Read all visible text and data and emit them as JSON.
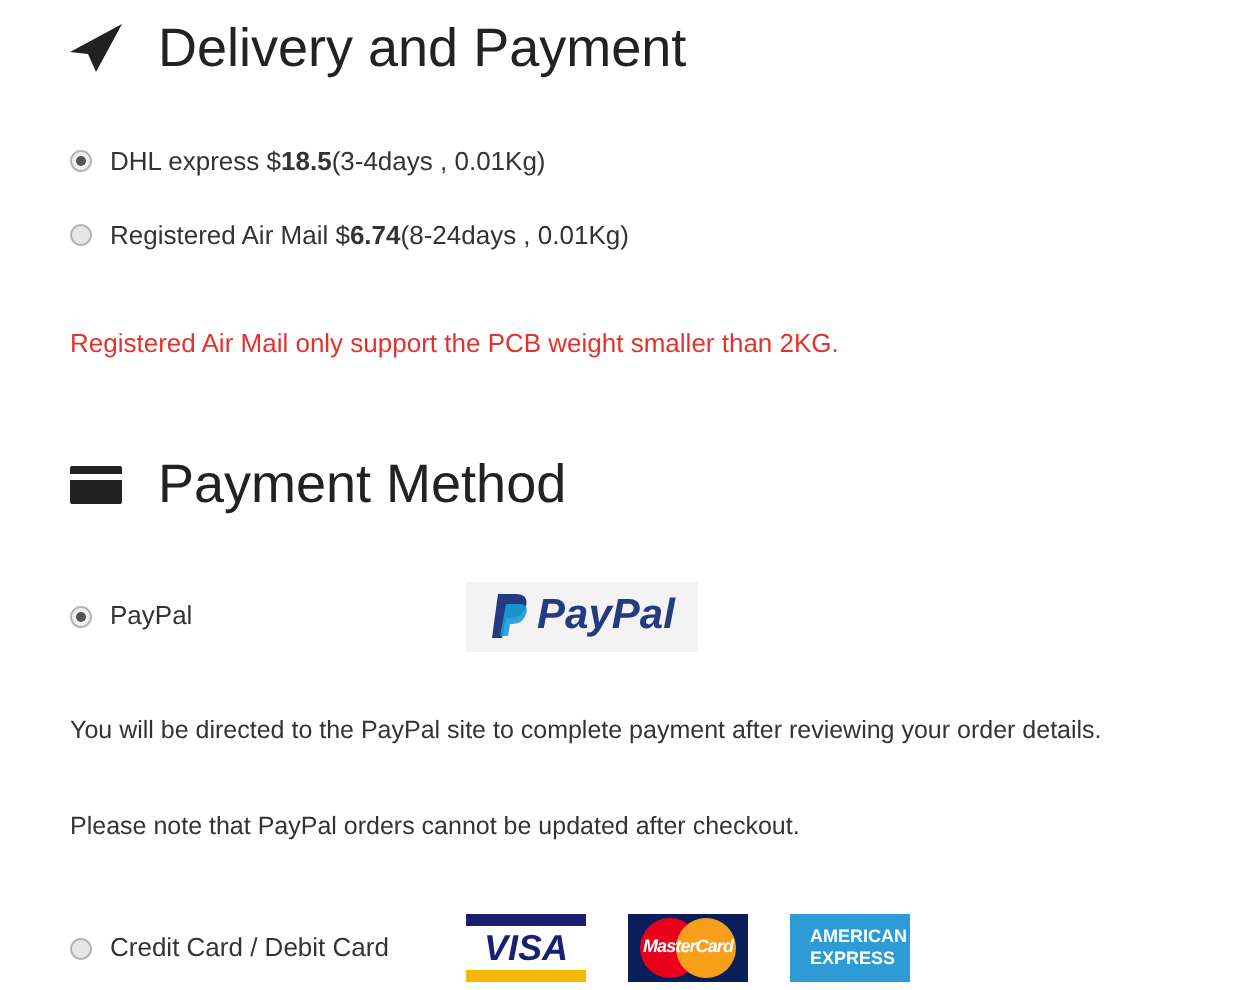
{
  "delivery": {
    "title": "Delivery and Payment",
    "options": [
      {
        "label": "DHL express $**18.5**(3-4days , 0.01Kg)",
        "selected": true
      },
      {
        "label": "Registered Air Mail $**6.74**(8-24days , 0.01Kg)",
        "selected": false
      }
    ],
    "warning": "Registered Air Mail only support the PCB weight smaller than 2KG."
  },
  "payment": {
    "title": "Payment Method",
    "methods": [
      {
        "label": "PayPal",
        "selected": true,
        "logos": [
          {
            "kind": "paypal",
            "text": "PayPal"
          }
        ],
        "notes": [
          "You will be directed to the PayPal site to complete payment after reviewing your order details.",
          "Please note that PayPal orders cannot be updated after checkout."
        ]
      },
      {
        "label": "Credit Card / Debit Card",
        "selected": false,
        "logos": [
          {
            "kind": "visa",
            "text": "VISA"
          },
          {
            "kind": "mastercard",
            "text": "MasterCard"
          },
          {
            "kind": "amex",
            "text": "AMERICAN EXPRESS"
          }
        ]
      }
    ]
  }
}
